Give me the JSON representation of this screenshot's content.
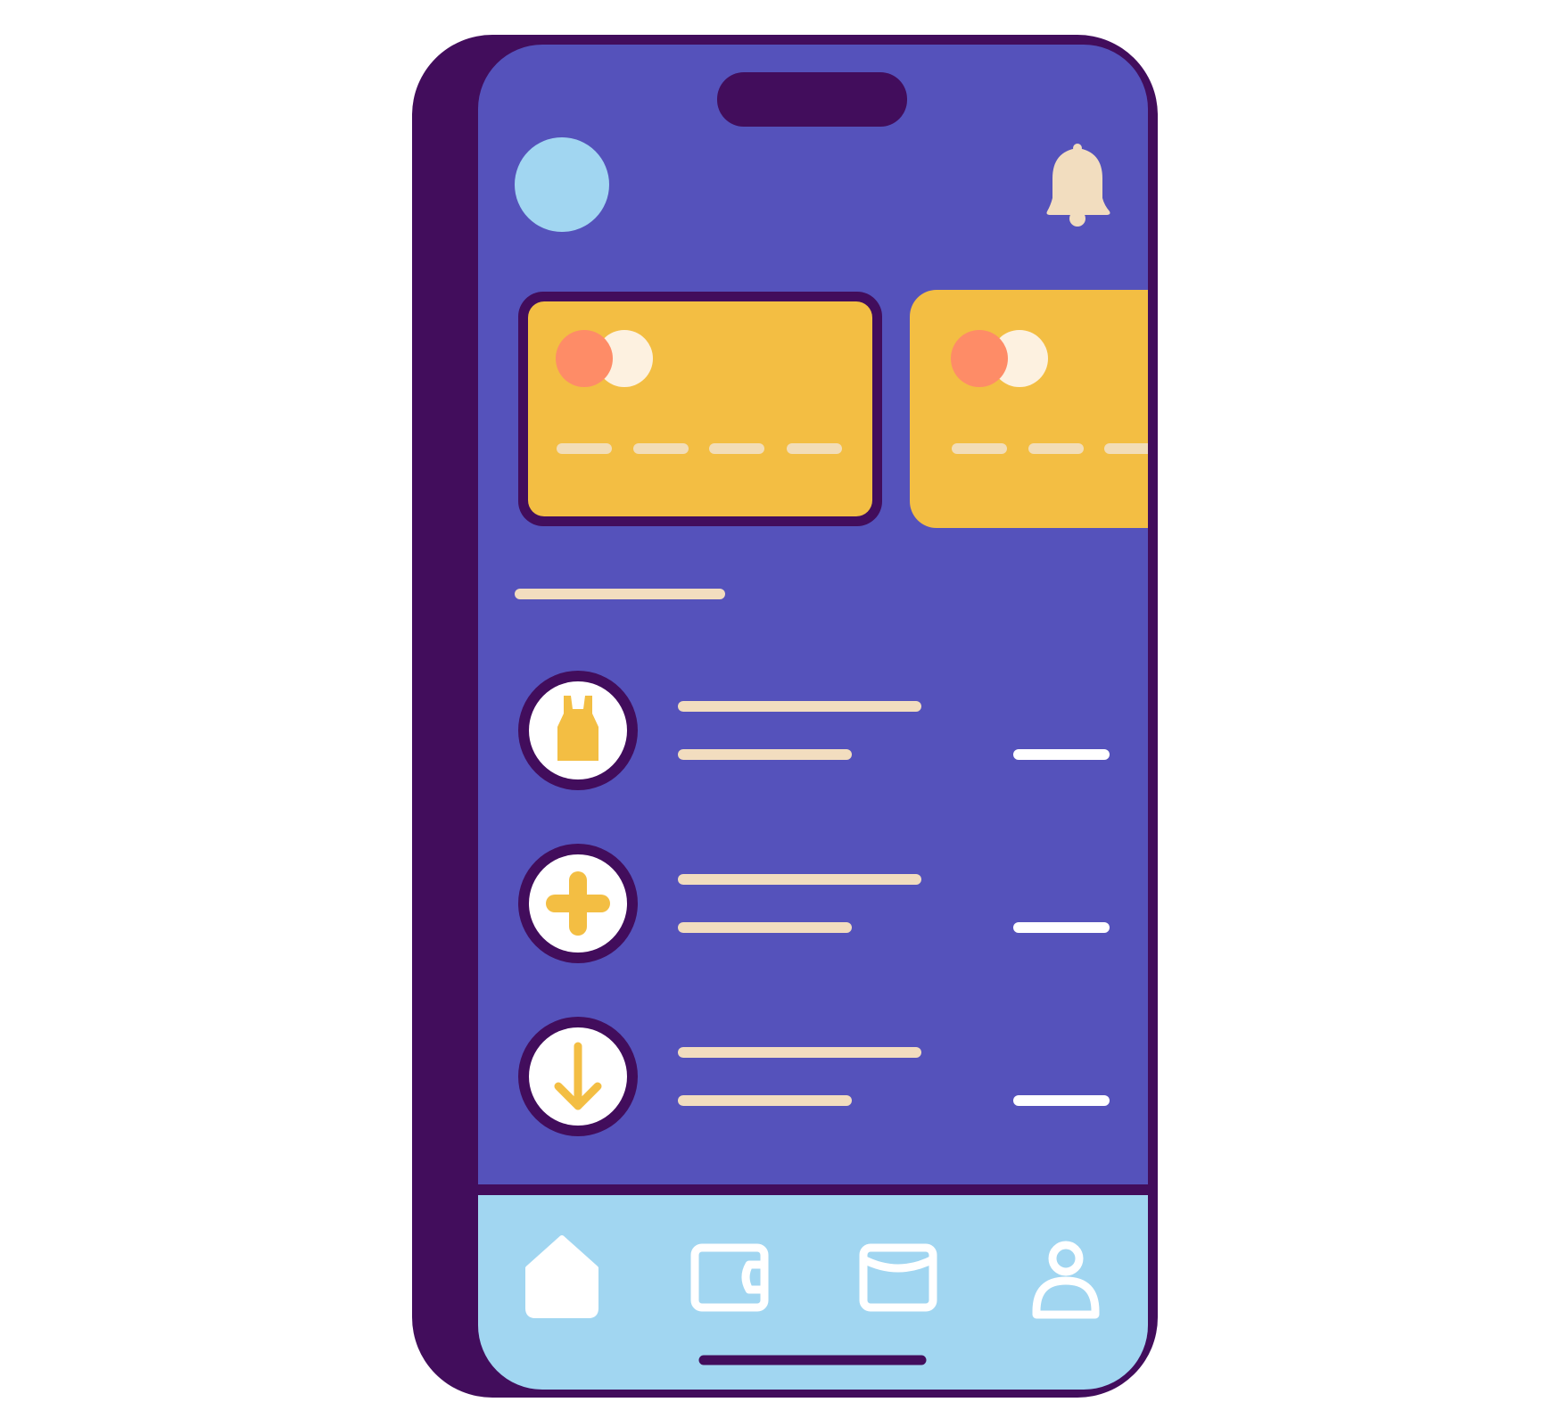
{
  "colors": {
    "frame": "#420d5c",
    "screen": "#5552bb",
    "card": "#f3be43",
    "card_dash": "#f2ddb8",
    "chip_red": "#fe8c67",
    "chip_cream": "#fdf1e0",
    "avatar": "#a1d6f1",
    "bell": "#f2ddbf",
    "placeholder_line": "#f2ddbf",
    "amount_line": "#ffffff",
    "nav_bar": "#a1d6f1",
    "icon_accent": "#f3be43"
  },
  "header": {
    "avatar_icon": "avatar",
    "notification_icon": "bell-icon"
  },
  "cards": [
    {
      "icon": "mastercard-logo",
      "selected": true
    },
    {
      "icon": "mastercard-logo",
      "selected": false
    }
  ],
  "transactions": [
    {
      "icon": "dress-icon"
    },
    {
      "icon": "plus-icon"
    },
    {
      "icon": "arrow-down-icon"
    }
  ],
  "nav": [
    {
      "icon": "home-icon",
      "active": true
    },
    {
      "icon": "wallet-icon",
      "active": false
    },
    {
      "icon": "mail-icon",
      "active": false
    },
    {
      "icon": "profile-icon",
      "active": false
    }
  ]
}
